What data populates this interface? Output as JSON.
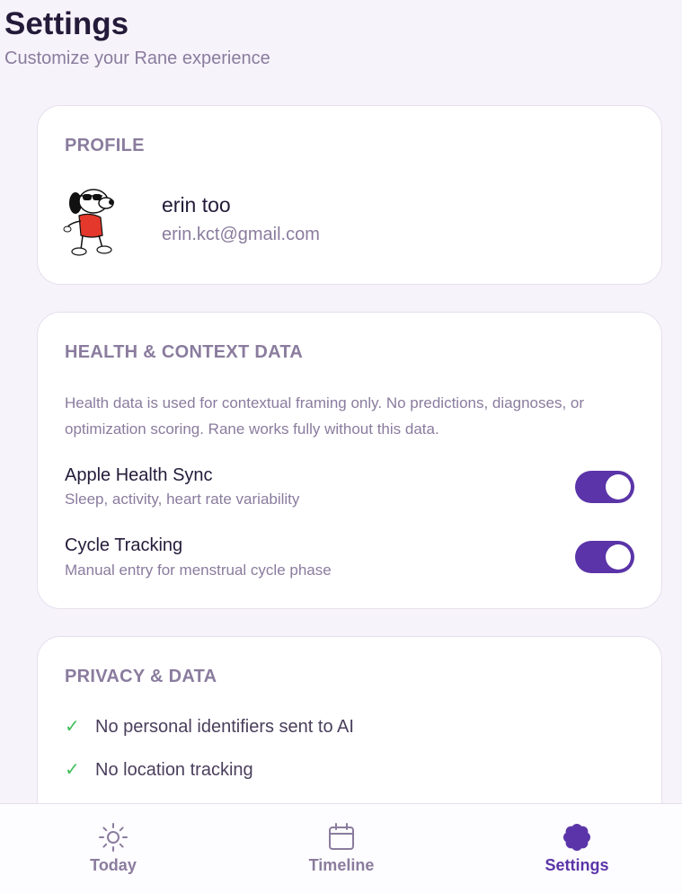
{
  "header": {
    "title": "Settings",
    "subtitle": "Customize your Rane experience"
  },
  "profile": {
    "section_label": "PROFILE",
    "name": "erin too",
    "email": "erin.kct@gmail.com"
  },
  "health": {
    "section_label": "HEALTH & CONTEXT DATA",
    "description": "Health data is used for contextual framing only. No predictions, diagnoses, or optimization scoring. Rane works fully without this data.",
    "settings": [
      {
        "title": "Apple Health Sync",
        "description": "Sleep, activity, heart rate variability",
        "enabled": true
      },
      {
        "title": "Cycle Tracking",
        "description": "Manual entry for menstrual cycle phase",
        "enabled": true
      }
    ]
  },
  "privacy": {
    "section_label": "PRIVACY & DATA",
    "items": [
      {
        "check": "✓",
        "text": "No personal identifiers sent to AI"
      },
      {
        "check": "✓",
        "text": "No location tracking"
      }
    ]
  },
  "nav": {
    "items": [
      {
        "label": "Today",
        "icon": "sun-icon",
        "active": false
      },
      {
        "label": "Timeline",
        "icon": "calendar-icon",
        "active": false
      },
      {
        "label": "Settings",
        "icon": "flower-icon",
        "active": true
      }
    ]
  },
  "colors": {
    "accent": "#5a34a8",
    "check": "#3fbf5a",
    "background": "#f6f3fa"
  }
}
